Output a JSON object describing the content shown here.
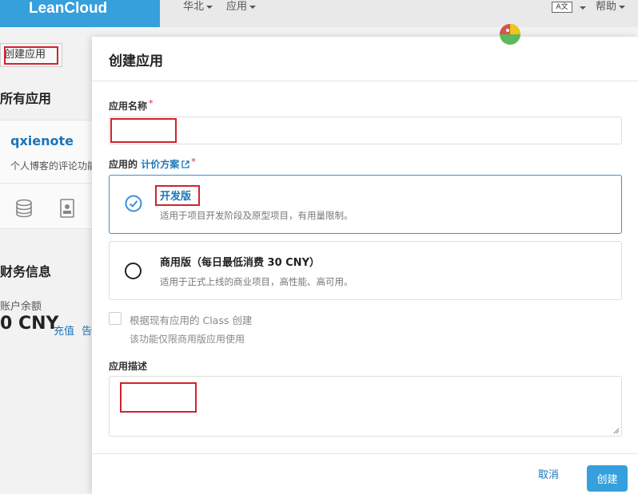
{
  "topbar": {
    "brand": "LeanCloud",
    "region": "华北",
    "apps_menu": "应用",
    "lang_icon": "A文",
    "help": "帮助"
  },
  "background": {
    "create_app_button": "创建应用",
    "all_apps_heading": "所有应用",
    "app_card": {
      "name": "qxienote",
      "description": "个人博客的评论功能",
      "icons": [
        "database-icon",
        "contact-card-icon"
      ]
    },
    "finance_heading": "财务信息",
    "balance_label": "账户余额",
    "balance_value": "0 CNY",
    "recharge_link": "充值",
    "alert_link": "告"
  },
  "modal": {
    "title": "创建应用",
    "app_name_label": "应用名称",
    "app_name_value": "",
    "pricing_label_prefix": "应用的",
    "pricing_link": "计价方案",
    "required_mark": "*",
    "plans": [
      {
        "title": "开发版",
        "description": "适用于项目开发阶段及原型项目，有用量限制。",
        "selected": true
      },
      {
        "title": "商用版（每日最低消费 30 CNY）",
        "description": "适用于正式上线的商业项目，高性能、高可用。",
        "selected": false
      }
    ],
    "clone_checkbox_label": "根据现有应用的 Class 创建",
    "clone_checkbox_help": "该功能仅限商用版应用使用",
    "description_label": "应用描述",
    "description_value": "",
    "cancel_button": "取消",
    "create_button": "创建"
  },
  "colors": {
    "brand_blue": "#35a0dc",
    "link_blue": "#1b75b8",
    "required_red": "#d0232e",
    "annotation_red": "#d0232e"
  }
}
